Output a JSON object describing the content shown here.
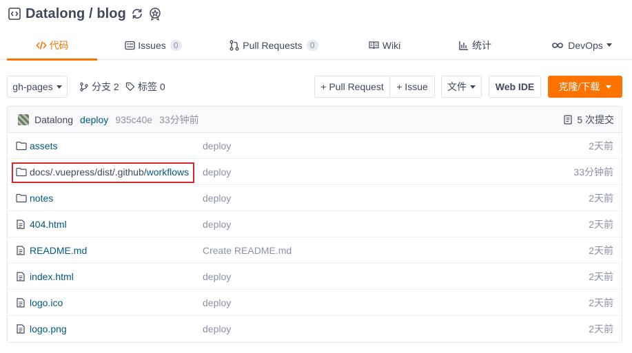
{
  "repo": {
    "title": "Datalong / blog",
    "icons": [
      "code-box-icon",
      "sync-icon",
      "award-icon"
    ]
  },
  "tabs": [
    {
      "label": "代码",
      "icon": "code-icon",
      "active": true
    },
    {
      "label": "Issues",
      "badge": "0",
      "icon": "issues-icon"
    },
    {
      "label": "Pull Requests",
      "badge": "0",
      "icon": "pull-request-icon"
    },
    {
      "label": "Wiki",
      "icon": "book-icon"
    },
    {
      "label": "统计",
      "icon": "bar-chart-icon"
    },
    {
      "label": "DevOps",
      "icon": "infinity-icon",
      "dropdown": true
    }
  ],
  "toolbar": {
    "branch": "gh-pages",
    "branches": "分支 2",
    "tags": "标签 0",
    "pull_request_btn": "+ Pull Request",
    "issue_btn": "+ Issue",
    "file_btn": "文件",
    "web_ide_btn": "Web IDE",
    "clone_btn": "克隆/下载",
    "accent_color": "#fe7300"
  },
  "commit": {
    "author": "Datalong",
    "message": "deploy",
    "sha": "935c40e",
    "time": "33分钟前",
    "count": "5 次提交"
  },
  "files": [
    {
      "type": "folder",
      "name": "assets",
      "message": "deploy",
      "time": "2天前"
    },
    {
      "type": "folder",
      "name_dim": "docs/.vuepress/dist/.github/",
      "name": "workflows",
      "message": "deploy",
      "time": "33分钟前",
      "highlighted": true
    },
    {
      "type": "folder",
      "name": "notes",
      "message": "deploy",
      "time": "2天前"
    },
    {
      "type": "file",
      "name": "404.html",
      "message": "deploy",
      "time": "2天前"
    },
    {
      "type": "file",
      "name": "README.md",
      "message": "Create README.md",
      "time": "2天前"
    },
    {
      "type": "file",
      "name": "index.html",
      "message": "deploy",
      "time": "2天前"
    },
    {
      "type": "file",
      "name": "logo.ico",
      "message": "deploy",
      "time": "2天前"
    },
    {
      "type": "file",
      "name": "logo.png",
      "message": "deploy",
      "time": "2天前"
    }
  ]
}
